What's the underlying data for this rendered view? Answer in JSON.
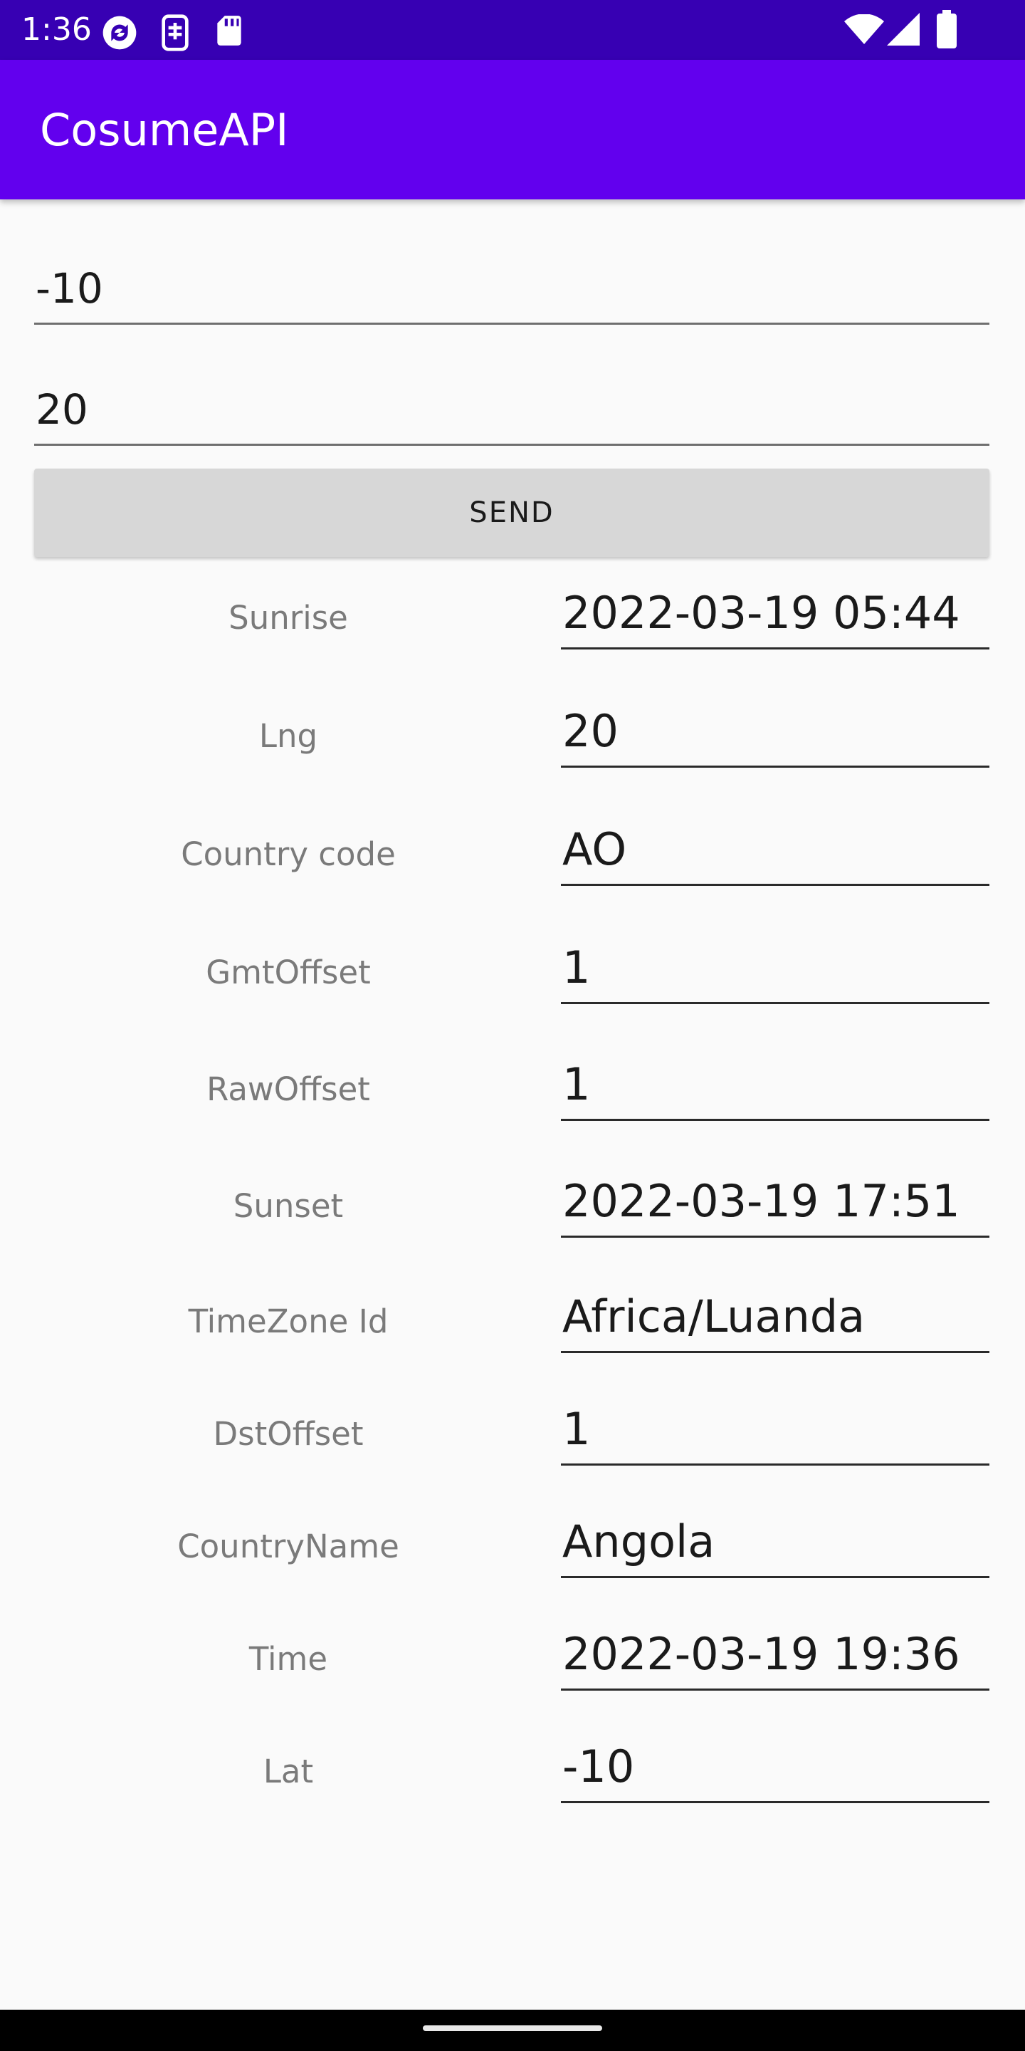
{
  "status_bar": {
    "time": "1:36",
    "left_icons": [
      "sync-icon",
      "sim-storage-icon",
      "sd-card-icon"
    ],
    "right_icons": [
      "wifi-icon",
      "cellular-signal-icon",
      "battery-icon"
    ],
    "background": "#3700b3"
  },
  "app_bar": {
    "title": "CosumeAPI",
    "background": "#6200ee"
  },
  "inputs": {
    "latitude_value": "-10",
    "longitude_value": "20"
  },
  "send_button": {
    "label": "SEND"
  },
  "results": [
    {
      "label": "Sunrise",
      "value": "2022-03-19 05:44"
    },
    {
      "label": "Lng",
      "value": "20"
    },
    {
      "label": "Country code",
      "value": "AO"
    },
    {
      "label": "GmtOffset",
      "value": "1"
    },
    {
      "label": "RawOffset",
      "value": "1"
    },
    {
      "label": "Sunset",
      "value": "2022-03-19 17:51"
    },
    {
      "label": "TimeZone Id",
      "value": "Africa/Luanda"
    },
    {
      "label": "DstOffset",
      "value": "1"
    },
    {
      "label": "CountryName",
      "value": "Angola"
    },
    {
      "label": "Time",
      "value": "2022-03-19 19:36"
    },
    {
      "label": "Lat",
      "value": "-10"
    }
  ]
}
